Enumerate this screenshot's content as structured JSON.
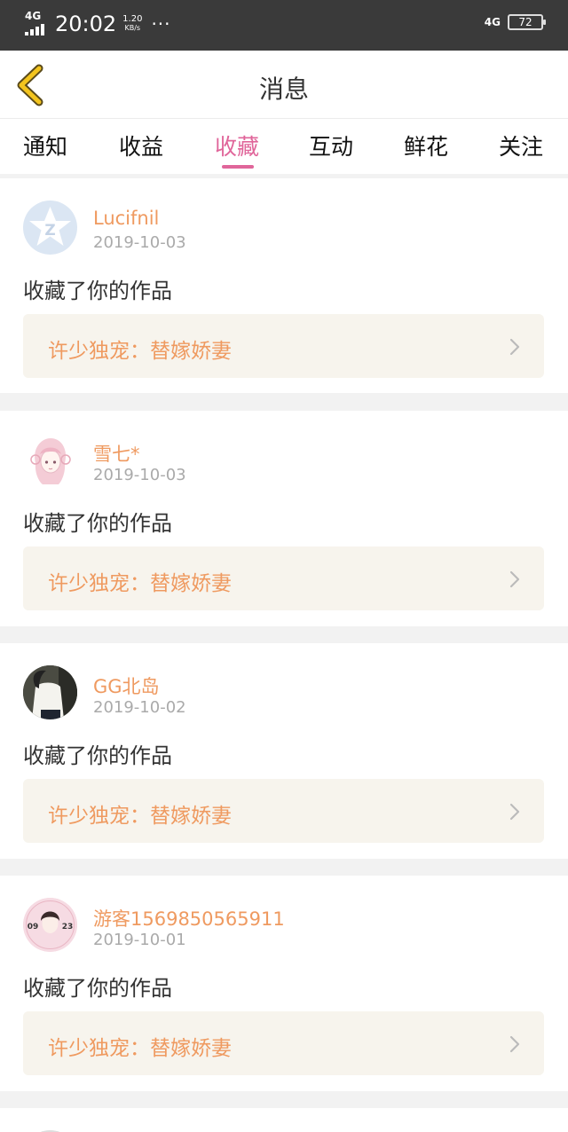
{
  "status_bar": {
    "network": "4G",
    "time": "20:02",
    "speed_value": "1.20",
    "speed_unit": "KB/s",
    "more": "···",
    "network_right": "4G",
    "battery": "72"
  },
  "header": {
    "back_icon": "chevron-left-icon",
    "title": "消息"
  },
  "tabs": [
    {
      "label": "通知"
    },
    {
      "label": "收益"
    },
    {
      "label": "收藏",
      "active": true
    },
    {
      "label": "互动"
    },
    {
      "label": "鲜花"
    },
    {
      "label": "关注"
    }
  ],
  "colors": {
    "accent": "#e0659a",
    "name": "#ef9a60",
    "work_bg": "#f7f4ed"
  },
  "messages": [
    {
      "user": "Lucifnil",
      "date": "2019-10-03",
      "action": "收藏了你的作品",
      "work": "许少独宠：替嫁娇妻"
    },
    {
      "user": "雪七*",
      "date": "2019-10-03",
      "action": "收藏了你的作品",
      "work": "许少独宠：替嫁娇妻"
    },
    {
      "user": "GG北岛",
      "date": "2019-10-02",
      "action": "收藏了你的作品",
      "work": "许少独宠：替嫁娇妻"
    },
    {
      "user": "游客1569850565911",
      "date": "2019-10-01",
      "action": "收藏了你的作品",
      "work": "许少独宠：替嫁娇妻",
      "avatar_text_left": "09",
      "avatar_text_right": "23"
    }
  ]
}
